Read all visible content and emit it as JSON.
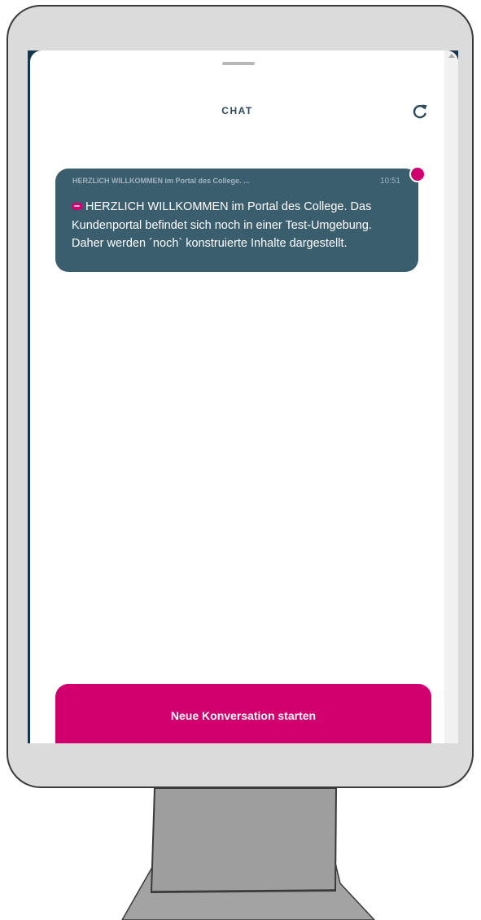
{
  "header": {
    "title": "CHAT"
  },
  "icons": {
    "refresh": "refresh-icon",
    "sender": "college-logo-icon"
  },
  "message": {
    "preview": "HERZLICH WILLKOMMEN im Portal des College. ...",
    "time": "10:51",
    "body": "HERZLICH WILLKOMMEN im Portal des College. Das Kundenportal befindet sich noch in einer Test-Umgebung. Daher werden ´noch` konstruierte Inhalte dargestellt.",
    "unread": true
  },
  "cta": {
    "label": "Neue Konversation starten"
  },
  "colors": {
    "accent": "#d1006e",
    "bubble": "#3b5e6f",
    "header_text": "#2d4a5c",
    "screen_frame": "#17344a"
  }
}
